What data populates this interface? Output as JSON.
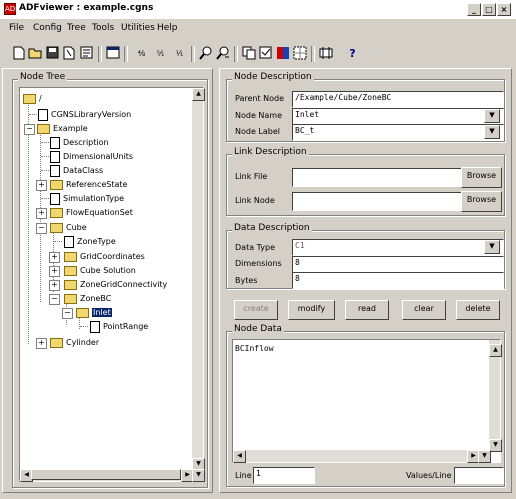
{
  "window": {
    "title": "ADFviewer : example.cgns",
    "app_icon": "ADF",
    "controls": {
      "minimize": "_",
      "maximize": "□",
      "close": "×"
    }
  },
  "menubar": [
    "File",
    "Config",
    "Tree",
    "Tools",
    "Utilities",
    "Help"
  ],
  "toolbar": {
    "icons": [
      "new-file-icon",
      "open-file-icon",
      "save-icon",
      "copy-file-icon",
      "properties-icon",
      "tree-view-icon",
      "link-icon",
      "unlink-icon",
      "node-type-icon",
      "find-icon",
      "find-next-icon",
      "paste-node-icon",
      "check-node-icon",
      "plot-icon",
      "grid-icon",
      "config-icon",
      "help-icon"
    ],
    "help_label": "?"
  },
  "node_tree": {
    "title": "Node Tree",
    "rows": [
      {
        "label": "/",
        "type": "folder"
      },
      {
        "label": "CGNSLibraryVersion",
        "type": "doc"
      },
      {
        "label": "Example",
        "type": "folder"
      },
      {
        "label": "Description",
        "type": "doc"
      },
      {
        "label": "DimensionalUnits",
        "type": "doc"
      },
      {
        "label": "DataClass",
        "type": "doc"
      },
      {
        "label": "ReferenceState",
        "type": "folder"
      },
      {
        "label": "SimulationType",
        "type": "doc"
      },
      {
        "label": "FlowEquationSet",
        "type": "folder"
      },
      {
        "label": "Cube",
        "type": "folder"
      },
      {
        "label": "ZoneType",
        "type": "doc"
      },
      {
        "label": "GridCoordinates",
        "type": "folder"
      },
      {
        "label": "Cube Solution",
        "type": "folder"
      },
      {
        "label": "ZoneGridConnectivity",
        "type": "folder"
      },
      {
        "label": "ZoneBC",
        "type": "folder"
      },
      {
        "label": "Inlet",
        "type": "folder",
        "selected": true
      },
      {
        "label": "PointRange",
        "type": "doc"
      },
      {
        "label": "Cylinder",
        "type": "folder"
      }
    ]
  },
  "node_description": {
    "title": "Node Description",
    "parent_node_label": "Parent Node",
    "parent_node_value": "/Example/Cube/ZoneBC",
    "node_name_label": "Node Name",
    "node_name_value": "Inlet",
    "node_label_label": "Node Label",
    "node_label_value": "BC_t"
  },
  "link_description": {
    "title": "Link Description",
    "link_file_label": "Link File",
    "link_file_value": "",
    "link_node_label": "Link Node",
    "link_node_value": "",
    "browse_label": "Browse"
  },
  "data_description": {
    "title": "Data Description",
    "data_type_label": "Data Type",
    "data_type_value": "C1",
    "dimensions_label": "Dimensions",
    "dimensions_value": "8",
    "bytes_label": "Bytes",
    "bytes_value": "8"
  },
  "actions": {
    "create": "create",
    "modify": "modify",
    "read": "read",
    "clear": "clear",
    "delete": "delete"
  },
  "node_data": {
    "title": "Node Data",
    "content": "BCInflow",
    "line_label": "Line",
    "line_value": "1",
    "values_per_line_label": "Values/Line",
    "values_per_line_value": ""
  }
}
